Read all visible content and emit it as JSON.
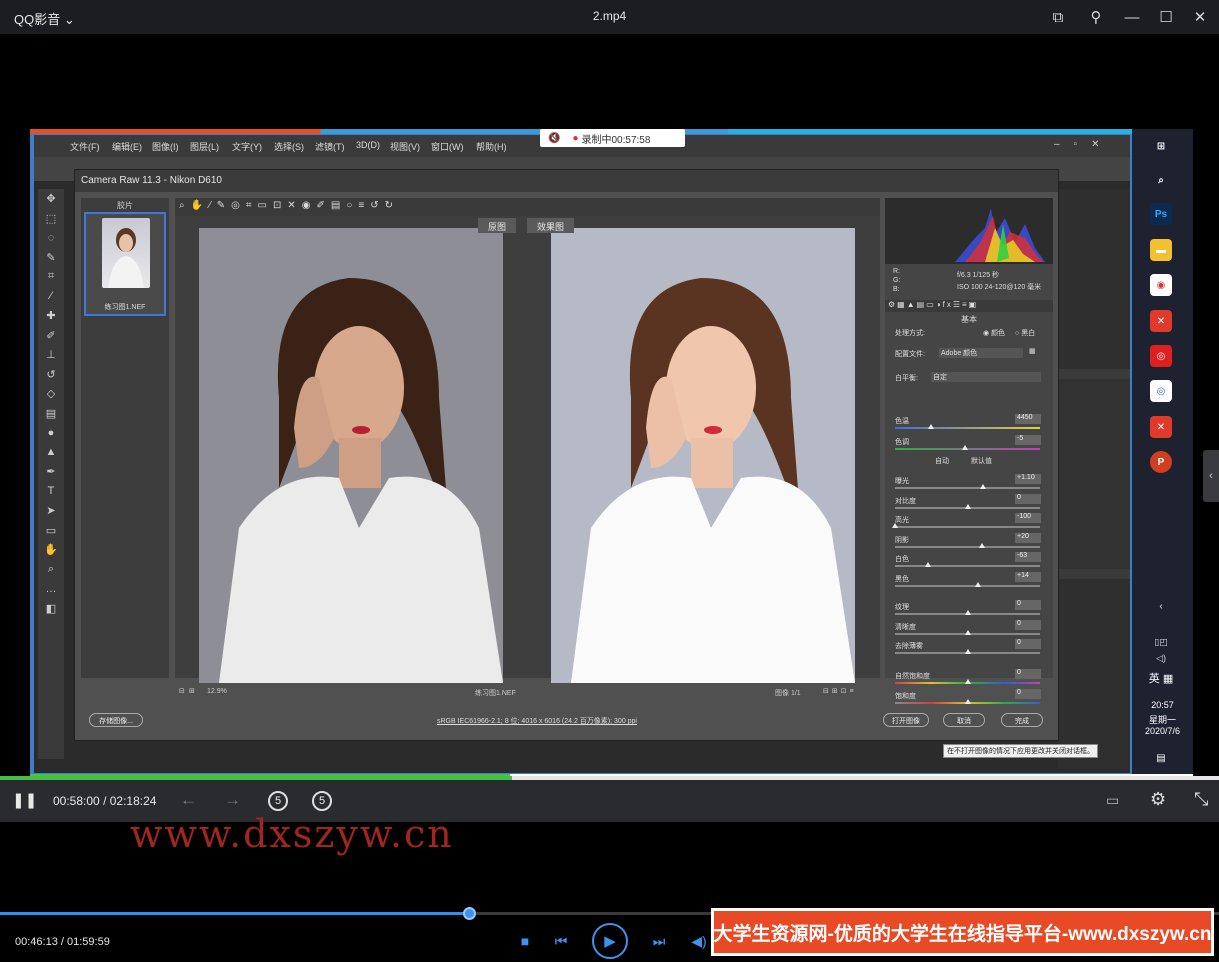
{
  "player": {
    "app_name": "QQ影音",
    "file_name": "2.mp4",
    "outer_time": "00:46:13 / 01:59:59",
    "outer_progress_fraction": 0.385
  },
  "inner_player": {
    "time_current": "00:58:00",
    "time_separator": "/",
    "time_total": "02:18:24",
    "rewind_seconds": "5",
    "forward_seconds": "5"
  },
  "recording": {
    "label": "录制中00:57:58"
  },
  "photoshop": {
    "menu": [
      "文件(F)",
      "编辑(E)",
      "图像(I)",
      "图层(L)",
      "文字(Y)",
      "选择(S)",
      "滤镜(T)",
      "3D(D)",
      "视图(V)",
      "窗口(W)",
      "帮助(H)"
    ]
  },
  "camera_raw": {
    "title": "Camera Raw 11.3 -  Nikon D610",
    "filmstrip_label": "胶片",
    "thumb_name": "练习图1.NEF",
    "view_before": "原图",
    "view_after": "效果图",
    "zoom": "12.9%",
    "file_label": "练习图1.NEF",
    "image_counter": "图像 1/1",
    "camera_info": {
      "r": "R:",
      "g": "G:",
      "b": "B:",
      "exposure": "f/6.3  1/125 秒",
      "iso": "ISO 100  24-120@120 毫米"
    },
    "panel_title": "基本",
    "treatment_label": "处理方式:",
    "treatment_color": "颜色",
    "treatment_bw": "黑白",
    "profile_label": "配置文件:",
    "profile_value": "Adobe 颜色",
    "wb_label": "白平衡:",
    "wb_value": "自定",
    "auto_label": "自动",
    "default_label": "默认值",
    "sliders": [
      {
        "label": "色温",
        "value": "4450",
        "position": 0.25
      },
      {
        "label": "色调",
        "value": "-5",
        "position": 0.48
      },
      {
        "label": "曝光",
        "value": "+1.10",
        "position": 0.61
      },
      {
        "label": "对比度",
        "value": "0",
        "position": 0.5
      },
      {
        "label": "高光",
        "value": "-100",
        "position": 0.0
      },
      {
        "label": "阴影",
        "value": "+20",
        "position": 0.6
      },
      {
        "label": "白色",
        "value": "-63",
        "position": 0.23
      },
      {
        "label": "黑色",
        "value": "+14",
        "position": 0.57
      },
      {
        "label": "纹理",
        "value": "0",
        "position": 0.5
      },
      {
        "label": "清晰度",
        "value": "0",
        "position": 0.5
      },
      {
        "label": "去除薄雾",
        "value": "0",
        "position": 0.5
      },
      {
        "label": "自然饱和度",
        "value": "0",
        "position": 0.5
      },
      {
        "label": "饱和度",
        "value": "0",
        "position": 0.5
      }
    ],
    "save_button": "存储图像...",
    "info_link": "sRGB IEC61966-2.1; 8 位; 4016 x 6016 (24.2 百万像素); 300 ppi",
    "open_button": "打开图像",
    "cancel_button": "取消",
    "done_button": "完成",
    "tooltip": "在不打开图像的情况下应用更改并关闭对话框。"
  },
  "taskbar": {
    "ime": "英",
    "time": "20:57",
    "weekday": "星期一",
    "date": "2020/7/6"
  },
  "watermark": "www.dxszyw.cn",
  "banner": "大学生资源网-优质的大学生在线指导平台-www.dxszyw.cn"
}
